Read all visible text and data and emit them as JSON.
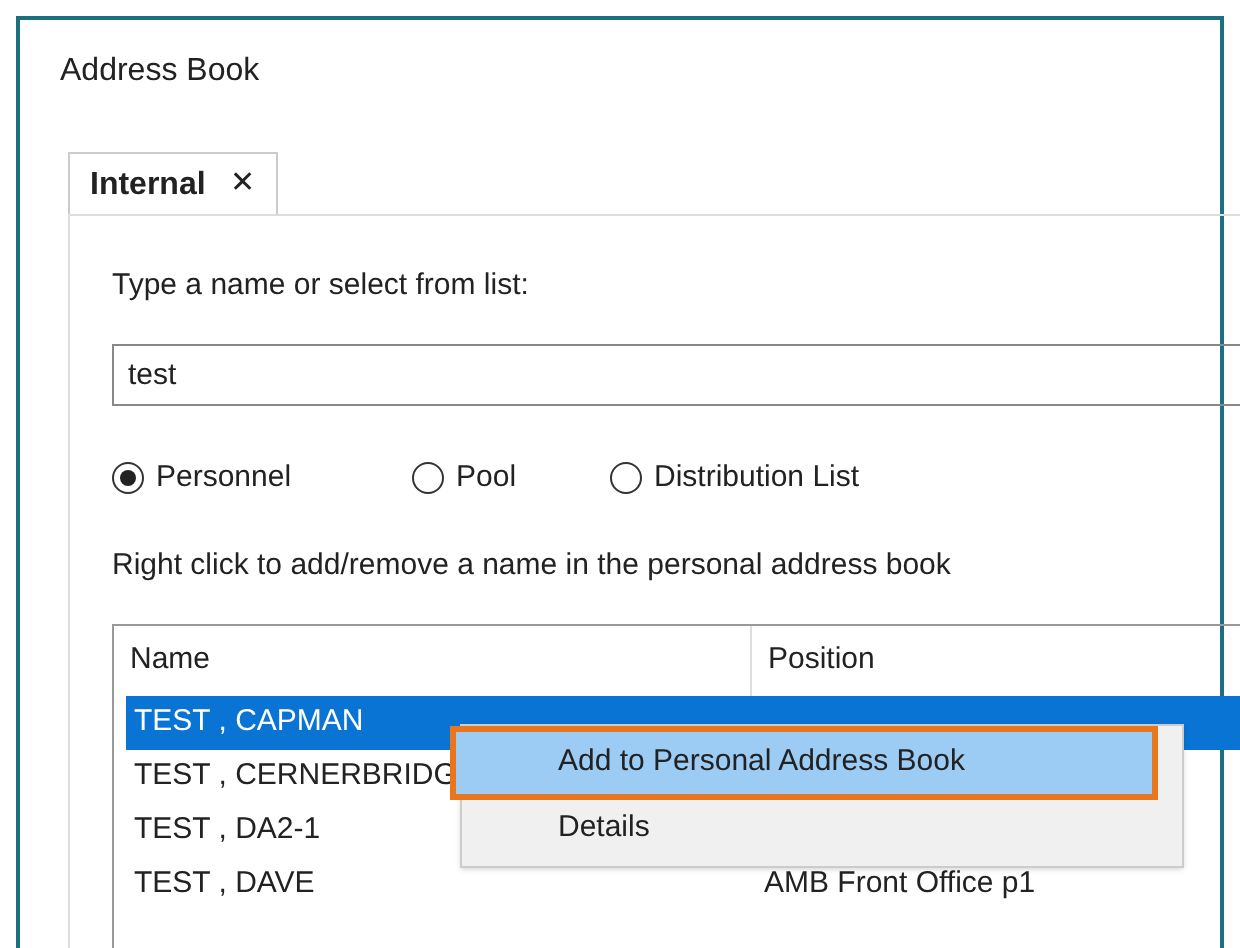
{
  "window": {
    "title": "Address Book"
  },
  "tabs": [
    {
      "label": "Internal",
      "close": "✕",
      "selected": true
    }
  ],
  "search": {
    "label": "Type a name or select from list:",
    "value": "test"
  },
  "radios": [
    {
      "label": "Personnel",
      "selected": true
    },
    {
      "label": "Pool",
      "selected": false
    },
    {
      "label": "Distribution List",
      "selected": false
    }
  ],
  "hint": "Right click to add/remove a name in the personal address book",
  "table": {
    "columns": [
      "Name",
      "Position"
    ],
    "rows": [
      {
        "name": "TEST , CAPMAN",
        "selected": true
      },
      {
        "name": "TEST , CERNERBRIDG",
        "selected": false
      },
      {
        "name": "TEST , DA2-1",
        "selected": false
      },
      {
        "name": "TEST , DAVE",
        "position": "AMB Front Office p1",
        "selected": false
      }
    ]
  },
  "context_menu": {
    "items": [
      {
        "label": "Add to Personal Address Book",
        "selected": true,
        "highlighted": true
      },
      {
        "label": "Details",
        "selected": false,
        "highlighted": false
      }
    ]
  }
}
